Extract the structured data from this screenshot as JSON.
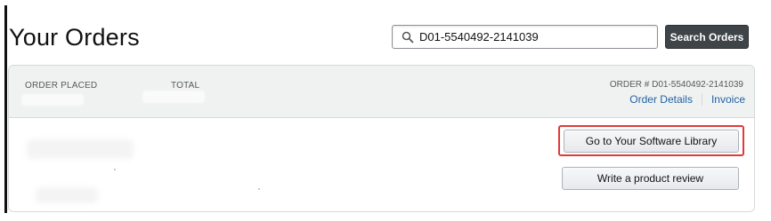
{
  "page": {
    "title": "Your Orders"
  },
  "search": {
    "value": "D01-5540492-2141039",
    "button_label": "Search Orders",
    "icon": "search-icon"
  },
  "order": {
    "header": {
      "placed_label": "ORDER PLACED",
      "total_label": "TOTAL",
      "order_number": "ORDER # D01-5540492-2141039",
      "order_details_link": "Order Details",
      "invoice_link": "Invoice"
    },
    "actions": {
      "library_button": "Go to Your Software Library",
      "review_button": "Write a product review"
    },
    "highlight_color": "#e03a3a"
  },
  "colors": {
    "link": "#2162a1",
    "search_button_bg": "#3f4448",
    "header_bg": "#f0f2f2"
  }
}
